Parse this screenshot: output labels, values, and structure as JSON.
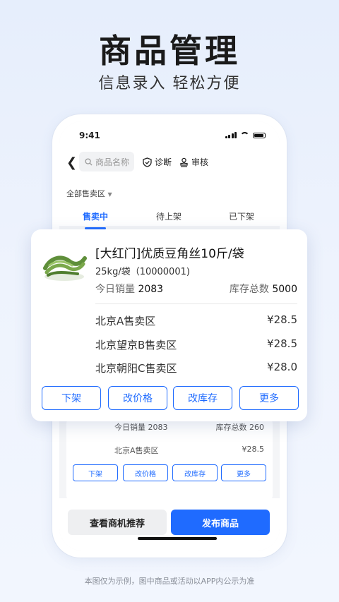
{
  "hero": {
    "title": "商品管理",
    "subtitle": "信息录入 轻松方便"
  },
  "status_bar": {
    "time": "9:41"
  },
  "nav": {
    "search_placeholder": "商品名称",
    "diagnose": "诊断",
    "review": "审核"
  },
  "zone_filter": "全部售卖区",
  "tabs": [
    {
      "label": "售卖中",
      "active": true
    },
    {
      "label": "待上架",
      "active": false
    },
    {
      "label": "已下架",
      "active": false
    }
  ],
  "featured_product": {
    "title": "[大红门]优质豆角丝10斤/袋",
    "spec": "25kg/袋（10000001)",
    "sales_label": "今日销量",
    "sales_value": "2083",
    "stock_label": "库存总数",
    "stock_value": "5000",
    "zones": [
      {
        "name": "北京A售卖区",
        "price": "¥28.5"
      },
      {
        "name": "北京望京B售卖区",
        "price": "¥28.5"
      },
      {
        "name": "北京朝阳C售卖区",
        "price": "¥28.0"
      }
    ],
    "actions": [
      "下架",
      "改价格",
      "改库存",
      "更多"
    ]
  },
  "background_card": {
    "sales_label": "今日销量",
    "sales_value": "2083",
    "stock_label": "库存总数",
    "stock_value": "260",
    "zone": "北京A售卖区",
    "price": "¥28.5",
    "actions": [
      "下架",
      "改价格",
      "改库存",
      "更多"
    ]
  },
  "bottom": {
    "secondary": "查看商机推荐",
    "primary": "发布商品"
  },
  "disclaimer": "本图仅为示例，图中商品或活动以APP内公示为准",
  "colors": {
    "accent": "#1f6bff"
  }
}
